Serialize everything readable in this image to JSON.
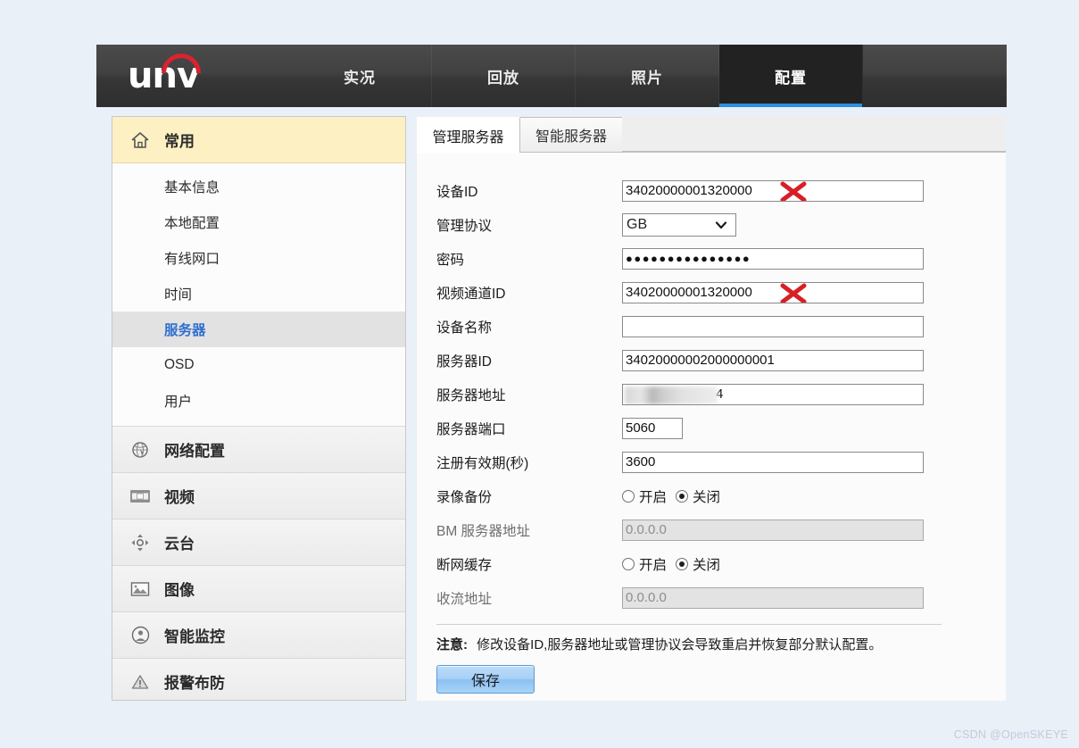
{
  "brand": {
    "logo_text": "unv"
  },
  "nav": {
    "tabs": [
      {
        "label": "实况",
        "active": false
      },
      {
        "label": "回放",
        "active": false
      },
      {
        "label": "照片",
        "active": false
      },
      {
        "label": "配置",
        "active": true
      }
    ]
  },
  "sidebar": {
    "groups": [
      {
        "label": "常用",
        "icon": "home-icon",
        "open": true,
        "items": [
          {
            "label": "基本信息",
            "selected": false
          },
          {
            "label": "本地配置",
            "selected": false
          },
          {
            "label": "有线网口",
            "selected": false
          },
          {
            "label": "时间",
            "selected": false
          },
          {
            "label": "服务器",
            "selected": true
          },
          {
            "label": "OSD",
            "selected": false
          },
          {
            "label": "用户",
            "selected": false
          }
        ]
      },
      {
        "label": "网络配置",
        "icon": "globe-icon",
        "open": false,
        "items": []
      },
      {
        "label": "视频",
        "icon": "film-icon",
        "open": false,
        "items": []
      },
      {
        "label": "云台",
        "icon": "ptz-icon",
        "open": false,
        "items": []
      },
      {
        "label": "图像",
        "icon": "image-icon",
        "open": false,
        "items": []
      },
      {
        "label": "智能监控",
        "icon": "smart-monitor-icon",
        "open": false,
        "items": []
      },
      {
        "label": "报警布防",
        "icon": "alarm-icon",
        "open": false,
        "items": []
      }
    ]
  },
  "main": {
    "tabs": [
      {
        "label": "管理服务器",
        "active": true
      },
      {
        "label": "智能服务器",
        "active": false
      }
    ],
    "fields": {
      "device_id": {
        "label": "设备ID",
        "value": "34020000001320000",
        "redacted": true
      },
      "protocol": {
        "label": "管理协议",
        "value": "GB",
        "options": [
          "GB"
        ]
      },
      "password": {
        "label": "密码",
        "value": "●●●●●●●●●●●●●●●"
      },
      "video_channel_id": {
        "label": "视频通道ID",
        "value": "34020000001320000",
        "redacted": true
      },
      "device_name": {
        "label": "设备名称",
        "value": ""
      },
      "server_id": {
        "label": "服务器ID",
        "value": "34020000002000000001"
      },
      "server_address": {
        "label": "服务器地址",
        "value": "4",
        "blurred": true
      },
      "server_port": {
        "label": "服务器端口",
        "value": "5060"
      },
      "register_validity": {
        "label": "注册有效期(秒)",
        "value": "3600"
      },
      "record_backup": {
        "label": "录像备份",
        "options": [
          {
            "label": "开启",
            "checked": false
          },
          {
            "label": "关闭",
            "checked": true
          }
        ]
      },
      "bm_server_address": {
        "label": "BM 服务器地址",
        "value": "0.0.0.0",
        "disabled": true
      },
      "offline_cache": {
        "label": "断网缓存",
        "options": [
          {
            "label": "开启",
            "checked": false
          },
          {
            "label": "关闭",
            "checked": true
          }
        ]
      },
      "stream_receive_address": {
        "label": "收流地址",
        "value": "0.0.0.0",
        "disabled": true
      }
    },
    "note_prefix": "注意:",
    "note_text": "修改设备ID,服务器地址或管理协议会导致重启并恢复部分默认配置。",
    "save_label": "保存"
  },
  "watermark": "CSDN @OpenSKEYE",
  "colors": {
    "accent_blue": "#2d8fe0",
    "logo_red": "#d9232e",
    "group_open_bg": "#fdf0c3",
    "selected_link": "#2f6fd0",
    "page_bg": "#eaf0f8"
  }
}
